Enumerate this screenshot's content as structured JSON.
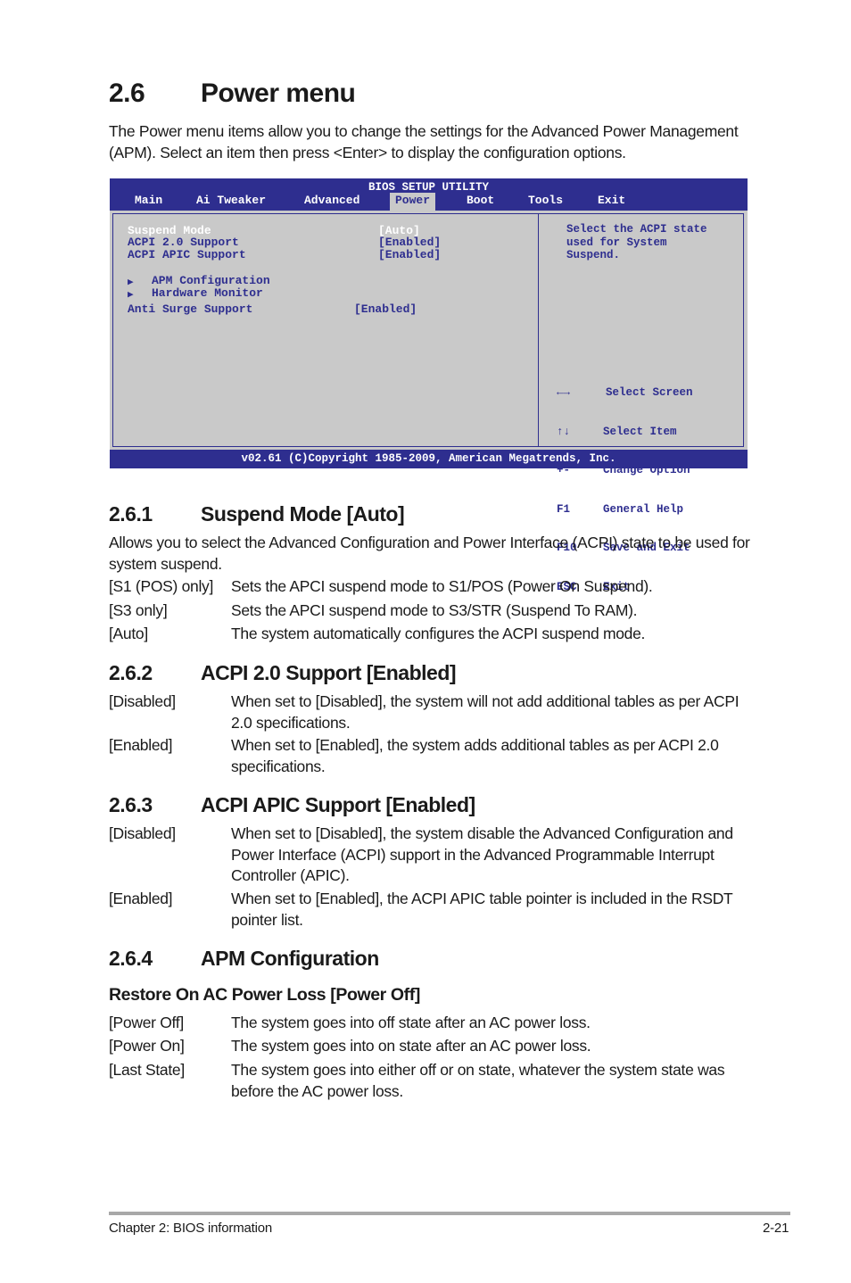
{
  "section": {
    "number": "2.6",
    "title": "Power menu",
    "intro": "The Power menu items allow you to change the settings for the Advanced Power Management (APM). Select an item then press <Enter> to display the configuration options."
  },
  "bios": {
    "title": "BIOS SETUP UTILITY",
    "tabs": [
      "Main",
      "Ai Tweaker",
      "Advanced",
      "Power",
      "Boot",
      "Tools",
      "Exit"
    ],
    "active_tab": "Power",
    "items": [
      {
        "label": "Suspend Mode",
        "value": "[Auto]",
        "selected": true
      },
      {
        "label": "ACPI 2.0 Support",
        "value": "[Enabled]"
      },
      {
        "label": "ACPI APIC Support",
        "value": "[Enabled]"
      },
      {
        "label": "APM Configuration",
        "submenu": true
      },
      {
        "label": "Hardware Monitor",
        "submenu": true
      },
      {
        "label": "Anti Surge Support",
        "value": "[Enabled]"
      }
    ],
    "help_text": [
      "Select the ACPI state",
      "used for System",
      "Suspend."
    ],
    "keys": [
      {
        "key": "←→",
        "action": "Select Screen"
      },
      {
        "key": "↑↓",
        "action": "Select Item"
      },
      {
        "key": "+-",
        "action": "Change Option"
      },
      {
        "key": "F1",
        "action": "General Help"
      },
      {
        "key": "F10",
        "action": "Save and Exit"
      },
      {
        "key": "ESC",
        "action": "Exit"
      }
    ],
    "footer": "v02.61 (C)Copyright 1985-2009, American Megatrends, Inc.",
    "colors": {
      "frame": "#2e2e8f",
      "background": "#c9c9c9",
      "text": "#2e2e8f",
      "selected_text": "#ffffff"
    }
  },
  "s1": {
    "number": "2.6.1",
    "title": "Suspend Mode [Auto]",
    "desc": "Allows you to select the Advanced Configuration and Power Interface (ACPI) state to be used for system suspend.",
    "options": [
      {
        "key": "[S1 (POS) only]",
        "text": "Sets the APCI suspend mode to S1/POS (Power On Suspend)."
      },
      {
        "key": "[S3 only]",
        "text": "Sets the APCI suspend mode to S3/STR (Suspend To RAM)."
      },
      {
        "key": "[Auto]",
        "text": "The system automatically configures the ACPI suspend mode."
      }
    ]
  },
  "s2": {
    "number": "2.6.2",
    "title": "ACPI 2.0 Support [Enabled]",
    "options": [
      {
        "key": "[Disabled]",
        "text": "When set to [Disabled], the system will not add additional tables as per ACPI 2.0 specifications."
      },
      {
        "key": "[Enabled]",
        "text": "When set to [Enabled], the system adds additional tables as per ACPI 2.0 specifications."
      }
    ]
  },
  "s3": {
    "number": "2.6.3",
    "title": "ACPI APIC Support [Enabled]",
    "options": [
      {
        "key": "[Disabled]",
        "text": "When set to [Disabled], the system disable the Advanced Configuration and Power Interface (ACPI) support in the Advanced Programmable Interrupt Controller (APIC)."
      },
      {
        "key": "[Enabled]",
        "text": "When set to [Enabled], the ACPI APIC table pointer is included in the RSDT pointer list."
      }
    ]
  },
  "s4": {
    "number": "2.6.4",
    "title": "APM Configuration",
    "subheading": "Restore On AC Power Loss [Power Off]",
    "options": [
      {
        "key": "[Power Off]",
        "text": "The system goes into off state after an AC power loss."
      },
      {
        "key": "[Power On]",
        "text": "The system goes into on state after an AC power loss."
      },
      {
        "key": "[Last State]",
        "text": "The system goes into either off or on state, whatever the system state was before the AC power loss."
      }
    ]
  },
  "footer": {
    "chapter": "Chapter 2: BIOS information",
    "page": "2-21"
  }
}
